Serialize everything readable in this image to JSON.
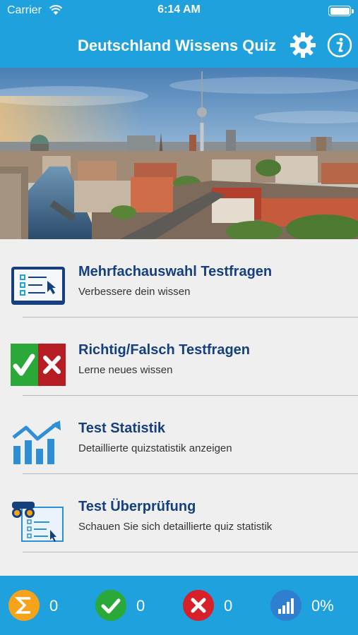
{
  "status_bar": {
    "carrier": "Carrier",
    "time": "6:14 AM"
  },
  "nav": {
    "title": "Deutschland Wissens Quiz",
    "settings_icon": "gear-icon",
    "info_icon": "info-icon"
  },
  "hero_image": "berlin-skyline-photo",
  "menu": [
    {
      "title": "Mehrfachauswahl Testfragen",
      "subtitle": "Verbessere dein wissen",
      "icon": "multiple-choice-icon"
    },
    {
      "title": "Richtig/Falsch Testfragen",
      "subtitle": "Lerne neues wissen",
      "icon": "true-false-icon"
    },
    {
      "title": "Test Statistik",
      "subtitle": "Detaillierte quizstatistik anzeigen",
      "icon": "statistics-chart-icon"
    },
    {
      "title": "Test Überprüfung",
      "subtitle": "Schauen Sie sich detaillierte quiz statistik",
      "icon": "review-binoculars-icon"
    }
  ],
  "stats": {
    "total": {
      "icon": "sigma-icon",
      "value": "0"
    },
    "correct": {
      "icon": "check-circle-icon",
      "value": "0"
    },
    "wrong": {
      "icon": "x-circle-icon",
      "value": "0"
    },
    "percent": {
      "icon": "progress-bars-icon",
      "value": "0%"
    }
  },
  "colors": {
    "brand_blue": "#1ea1dc",
    "title_navy": "#153f7e",
    "correct_green": "#2aa938",
    "wrong_red": "#d7202a",
    "sigma_orange": "#f5a31a"
  }
}
